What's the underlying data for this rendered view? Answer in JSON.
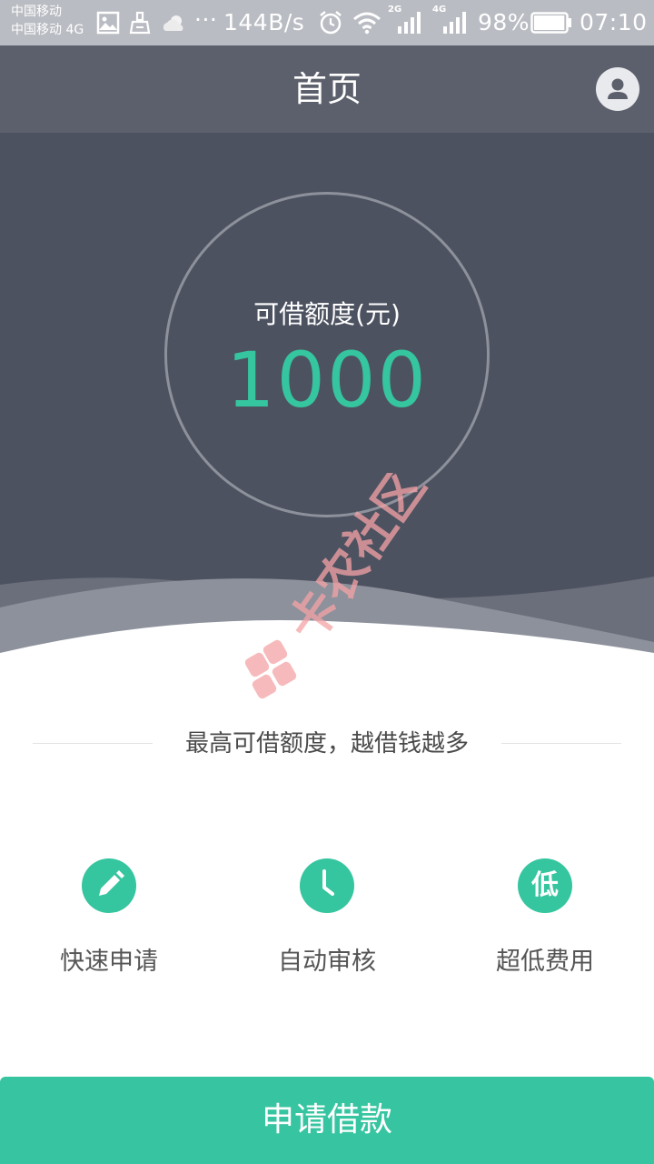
{
  "status_bar": {
    "carrier_1": "中国移动",
    "carrier_2": "中国移动 4G",
    "dots": "···",
    "speed": "144B/s",
    "net_2g": "2G",
    "net_4g": "4G",
    "battery": "98%",
    "battery_level": 0.98,
    "time": "07:10",
    "icons": [
      "image-icon",
      "cleaner-icon",
      "weather-cloud-icon",
      "alarm-icon",
      "wifi-icon",
      "signal-icon",
      "signal-icon",
      "battery-icon"
    ]
  },
  "header": {
    "title": "首页",
    "profile_icon": "user-avatar-icon"
  },
  "hero": {
    "label": "可借额度(元)",
    "value": "1000"
  },
  "watermark": {
    "text": "卡农社区",
    "color": "#f5a3a6"
  },
  "tagline": "最高可借额度，越借钱越多",
  "features": [
    {
      "label": "快速申请",
      "icon": "pencil-icon"
    },
    {
      "label": "自动审核",
      "icon": "clock-icon"
    },
    {
      "label": "超低费用",
      "icon": "low-icon",
      "glyph": "低"
    }
  ],
  "apply_button": "申请借款",
  "colors": {
    "accent": "#35c59f",
    "header_bg": "#5c606c",
    "hero_bg": "#4d5261",
    "status_bar_bg": "#b9bcc2"
  }
}
